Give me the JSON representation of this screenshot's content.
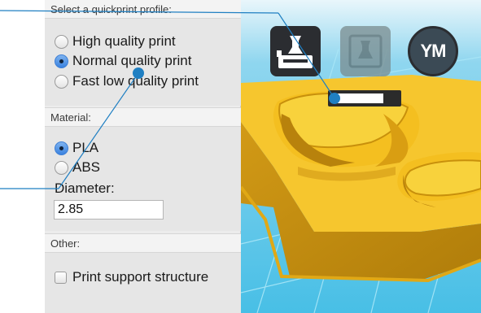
{
  "panel": {
    "profile_header": "Select a quickprint profile:",
    "profiles": [
      {
        "label": "High quality print",
        "checked": false
      },
      {
        "label": "Normal quality print",
        "checked": true
      },
      {
        "label": "Fast low quality print",
        "checked": false
      }
    ],
    "material_header": "Material:",
    "materials": [
      {
        "label": "PLA",
        "checked": true
      },
      {
        "label": "ABS",
        "checked": false
      }
    ],
    "diameter_label": "Diameter:",
    "diameter_value": "2.85",
    "other_header": "Other:",
    "support_label": "Print support structure",
    "support_checked": false
  },
  "viewport": {
    "toolbar": [
      {
        "icon": "load-model-icon",
        "enabled": true
      },
      {
        "icon": "print-icon",
        "enabled": false
      },
      {
        "icon": "youmagine-icon",
        "label": "YM",
        "enabled": true
      }
    ],
    "progress": 0.78,
    "colors": {
      "floor": "#59c4e6",
      "model": "#f5c433",
      "grid": "#a9e6f7"
    }
  }
}
